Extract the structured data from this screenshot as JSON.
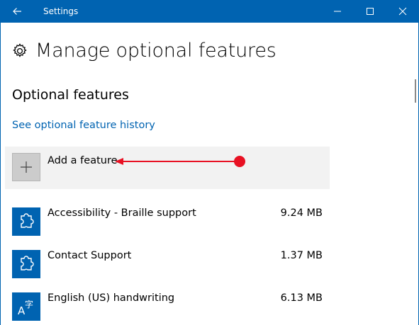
{
  "window": {
    "title": "Settings",
    "accent_color": "#0063b1",
    "back_icon": "back-arrow-icon",
    "minimize_icon": "minimize-icon",
    "maximize_icon": "maximize-icon",
    "close_icon": "close-icon"
  },
  "page": {
    "title": "Manage optional features",
    "title_icon": "gear-icon"
  },
  "optional_features": {
    "heading": "Optional features",
    "history_link": "See optional feature history",
    "add_feature": {
      "label": "Add a feature",
      "icon": "plus-icon"
    },
    "items": [
      {
        "name": "Accessibility - Braille support",
        "size": "9.24 MB",
        "icon": "puzzle-icon"
      },
      {
        "name": "Contact Support",
        "size": "1.37 MB",
        "icon": "puzzle-icon"
      },
      {
        "name": "English (US) handwriting",
        "size": "6.13 MB",
        "icon": "language-icon"
      }
    ]
  },
  "annotation": {
    "color": "#e81123"
  }
}
